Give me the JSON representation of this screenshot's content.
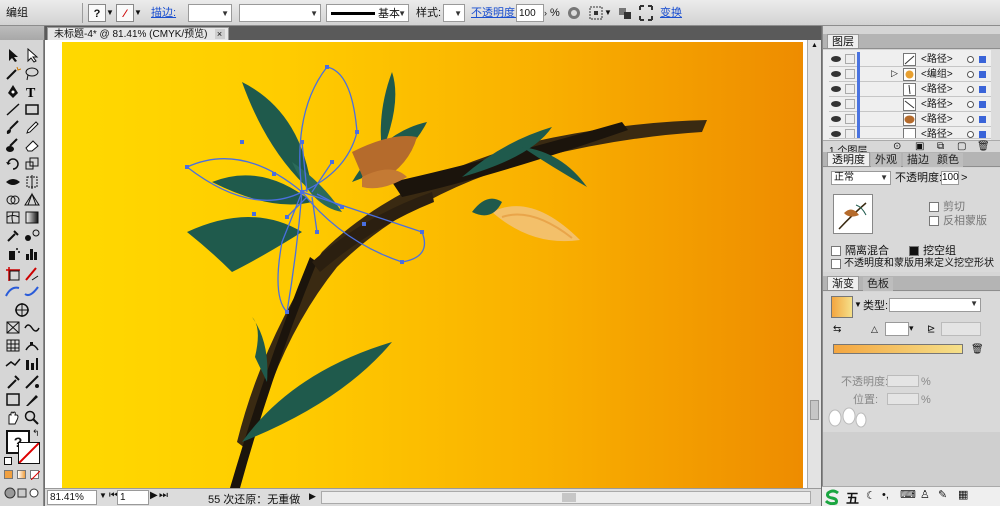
{
  "control_bar": {
    "selection_type": "编组",
    "stroke_label": "描边:",
    "stroke_profile": "基本",
    "style_label": "样式:",
    "opacity_label": "不透明度:",
    "opacity_value": "100",
    "opacity_unit": "%",
    "transform_label": "变换"
  },
  "document": {
    "tab_title": "未标题-4* @ 81.41% (CMYK/预览)",
    "close_glyph": "×"
  },
  "status_bar": {
    "zoom": "81.41%",
    "page": "1",
    "status_text": "55 次还原：无重做"
  },
  "layers_panel": {
    "tab": "图层",
    "rows": [
      {
        "name": "<路径>",
        "expand": ""
      },
      {
        "name": "<编组>",
        "expand": "▷"
      },
      {
        "name": "<路径>",
        "expand": ""
      },
      {
        "name": "<路径>",
        "expand": ""
      },
      {
        "name": "<路径>",
        "expand": ""
      },
      {
        "name": "<路径>",
        "expand": ""
      }
    ],
    "footer_count": "1 个图层"
  },
  "transparency_panel": {
    "tabs": [
      "透明度",
      "外观",
      "描边",
      "颜色"
    ],
    "blend_mode": "正常",
    "opacity_label": "不透明度:",
    "opacity_value": "100",
    "opacity_unit": ">",
    "clip_label": "剪切",
    "invert_mask_label": "反相蒙版",
    "isolate_blending_label": "隔离混合",
    "knockout_group_label": "挖空组",
    "define_knockout_label": "不透明度和蒙版用来定义挖空形状"
  },
  "gradient_panel": {
    "tabs": [
      "渐变",
      "色板"
    ],
    "type_label": "类型:",
    "opacity_label": "不透明度:",
    "location_label": "位置:",
    "percent": "%",
    "gradient_start": "#f4a640",
    "gradient_end": "#f5e08a"
  },
  "tray": {
    "ime_char": "五"
  },
  "colors": {
    "artboard_left": "#ffd900",
    "artboard_right": "#ee8c00",
    "leaf": "#1f5a4c",
    "stem": "#2a1c10",
    "selection": "#4a6fe0"
  }
}
